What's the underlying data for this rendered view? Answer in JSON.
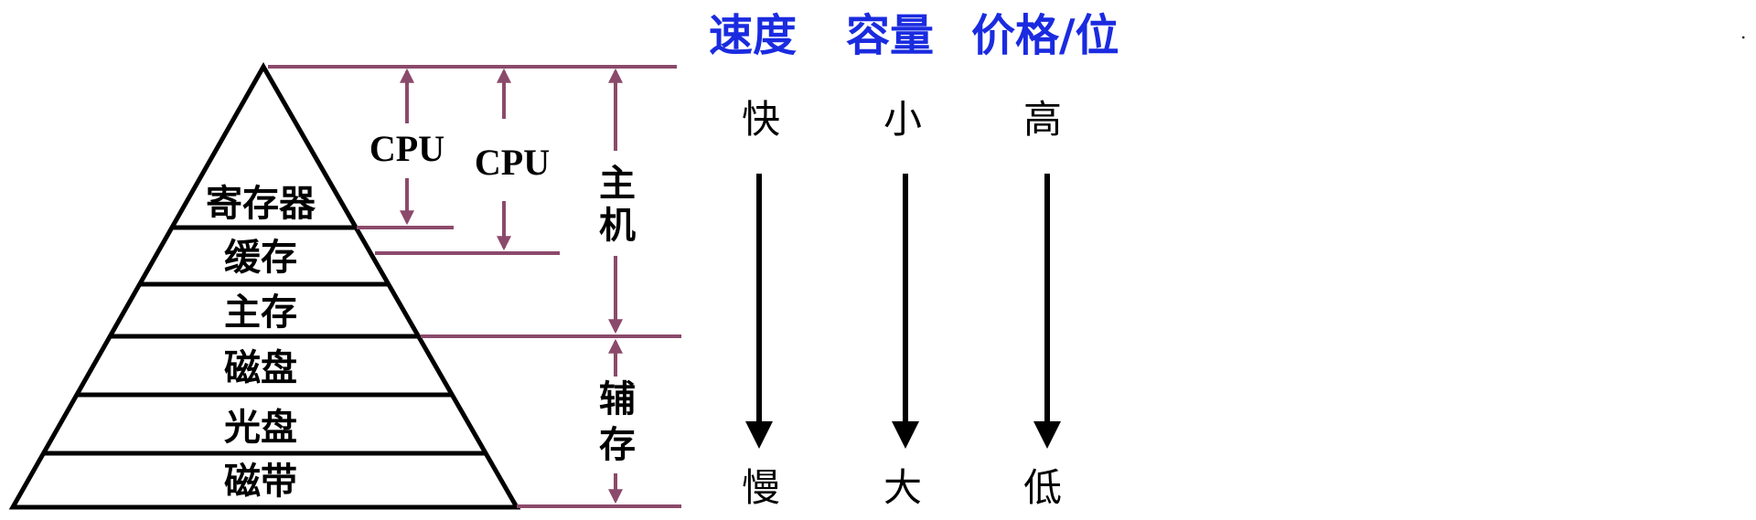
{
  "colors": {
    "header": "#1a2be0",
    "bracket": "#8b4a6b",
    "ink": "#000000"
  },
  "pyramid": {
    "levels": [
      "寄存器",
      "缓存",
      "主存",
      "磁盘",
      "光盘",
      "磁带"
    ]
  },
  "groups": {
    "cpu_1": "CPU",
    "cpu_2": "CPU",
    "host_1": "主",
    "host_2": "机",
    "aux_1": "辅",
    "aux_2": "存"
  },
  "header": {
    "speed": "速度",
    "capacity": "容量",
    "price": "价格/位"
  },
  "scale": {
    "speed_top": "快",
    "speed_bottom": "慢",
    "capacity_top": "小",
    "capacity_bottom": "大",
    "price_top": "高",
    "price_bottom": "低"
  },
  "corner_mark": "."
}
